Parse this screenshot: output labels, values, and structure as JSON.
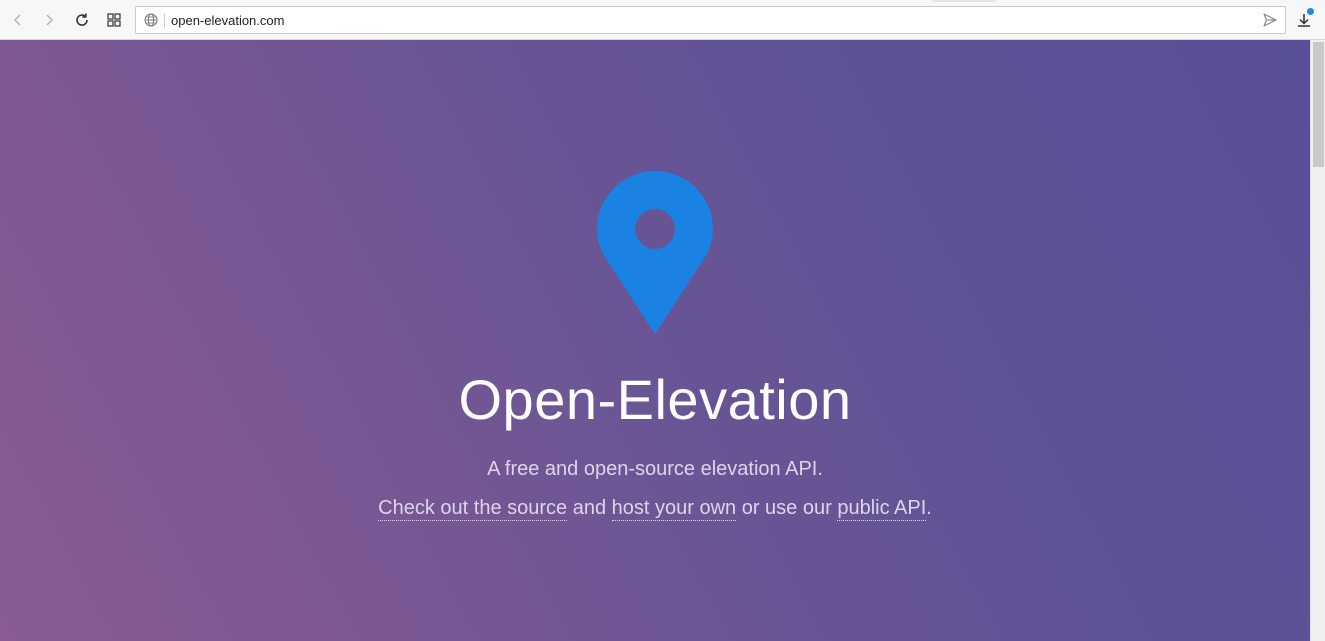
{
  "browser": {
    "url": "open-elevation.com",
    "icons": {
      "back": "back-arrow-icon",
      "forward": "forward-arrow-icon",
      "reload": "reload-icon",
      "tabs_grid": "grid-icon",
      "site": "globe-icon",
      "send": "send-icon",
      "download": "download-icon"
    },
    "download_badge_color": "#1a8ee8"
  },
  "hero": {
    "logo_icon": "map-pin-icon",
    "logo_color": "#1a82e2",
    "title": "Open-Elevation",
    "subtitle": "A free and open-source elevation API.",
    "cta": {
      "link1": "Check out the source",
      "text1": " and ",
      "link2": "host your own",
      "text2": " or use our ",
      "link3": "public API",
      "text3": "."
    }
  },
  "colors": {
    "gradient_left": "#8a5b94",
    "gradient_right": "#585097"
  }
}
